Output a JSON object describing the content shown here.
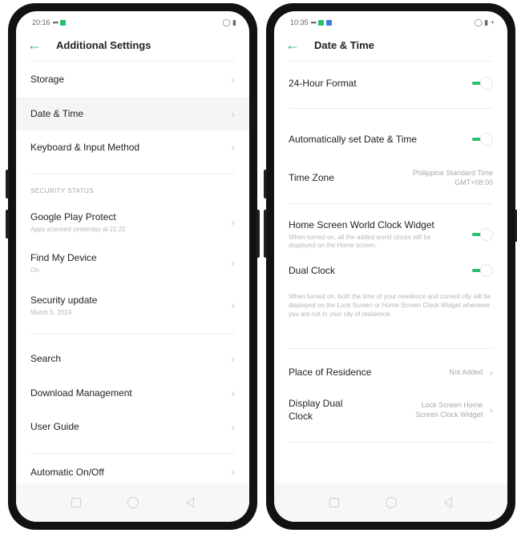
{
  "left": {
    "status": {
      "time": "20:16",
      "signal": "гат",
      "battery_icons": "★ ▯"
    },
    "header": {
      "title": "Additional Settings"
    },
    "items_top": [
      {
        "label": "Storage"
      },
      {
        "label": "Date & Time"
      },
      {
        "label": "Keyboard & Input Method"
      }
    ],
    "security_section": "SECURITY STATUS",
    "security_items": [
      {
        "label": "Google Play Protect",
        "sub": "Apps scanned yesterday at 21:22"
      },
      {
        "label": "Find My Device",
        "sub": "On"
      },
      {
        "label": "Security update",
        "sub": "March 5, 2019"
      }
    ],
    "items_bottom": [
      {
        "label": "Search"
      },
      {
        "label": "Download Management"
      },
      {
        "label": "User Guide"
      }
    ],
    "cut_item": "Automatic On/Off"
  },
  "right": {
    "status": {
      "time": "10:35",
      "battery": "▯ +"
    },
    "header": {
      "title": "Date & Time"
    },
    "format24": {
      "label": "24-Hour Format",
      "on": true
    },
    "auto_set": {
      "label": "Automatically set Date & Time",
      "on": true
    },
    "timezone": {
      "label": "Time Zone",
      "value": "Philippine Standard Time GMT+08:00"
    },
    "world_clock": {
      "label": "Home Screen World Clock Widget",
      "desc": "When turned on, all the added world clocks will be displayed on the Home screen.",
      "on": true
    },
    "dual_clock": {
      "label": "Dual Clock",
      "on": true,
      "desc": "When turned on, both the time of your residence and current city will be displayed on the Lock Screen or Home Screen Clock Widget whenever you are not in your city of residence."
    },
    "residence": {
      "label": "Place of Residence",
      "value": "Not Added"
    },
    "display_dual": {
      "label": "Display Dual Clock",
      "value": "Lock Screen Home Screen Clock Widget"
    }
  },
  "colors": {
    "accent": "#25c26b",
    "frame": "#121212"
  }
}
